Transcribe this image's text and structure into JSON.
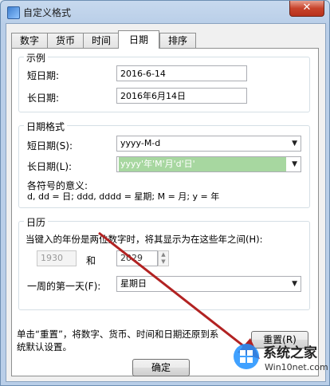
{
  "window": {
    "title": "自定义格式",
    "close_glyph": "✕"
  },
  "tabs": [
    {
      "label": "数字"
    },
    {
      "label": "货币"
    },
    {
      "label": "时间"
    },
    {
      "label": "日期"
    },
    {
      "label": "排序"
    }
  ],
  "example": {
    "title": "示例",
    "short_label": "短日期:",
    "short_value": "2016-6-14",
    "long_label": "长日期:",
    "long_value": "2016年6月14日"
  },
  "date_format": {
    "title": "日期格式",
    "short_label": "短日期(S):",
    "short_value": "yyyy-M-d",
    "long_label": "长日期(L):",
    "long_value": "yyyy'年'M'月'd'日'",
    "meaning_title": "各符号的意义:",
    "meaning_text": "d, dd = 日;  ddd, dddd = 星期;  M = 月;  y = 年"
  },
  "calendar": {
    "title": "日历",
    "desc": "当键入的年份是两位数字时，将其显示为在这些年之间(H):",
    "from_year": "1930",
    "and_label": "和",
    "to_year": "2029",
    "first_day_label": "一周的第一天(F):",
    "first_day_value": "星期日"
  },
  "footer": {
    "reset_desc_1": "单击“重置”，将数字、货币、时间和日期还原到系",
    "reset_desc_2": "统默认设置。",
    "reset_button": "重置(R)",
    "ok_button": "确定"
  },
  "watermark": {
    "brand": "系统之家",
    "site": "Win10net.com"
  },
  "colors": {
    "annotation_arrow": "#b22222",
    "selection": "#a7d7a0"
  }
}
